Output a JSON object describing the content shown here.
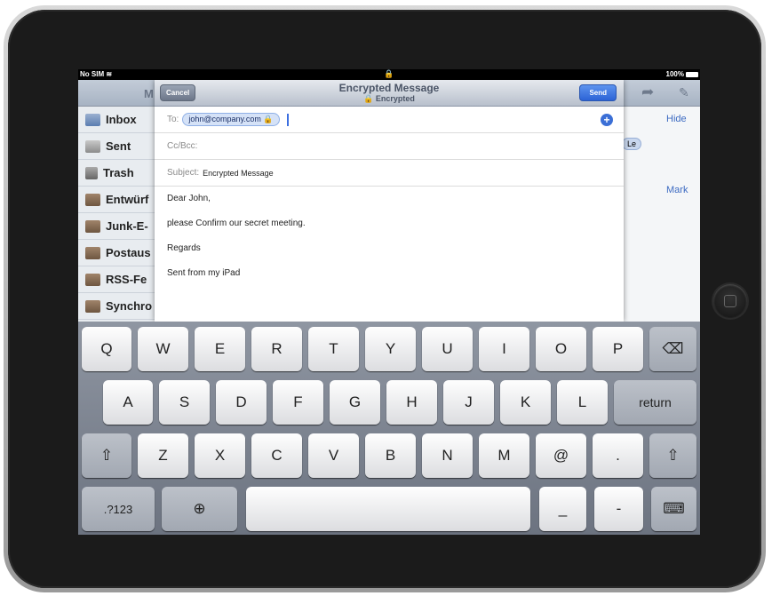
{
  "status_bar": {
    "carrier": "No SIM",
    "wifi_icon": "wifi-icon",
    "lock_icon": "padlock-icon",
    "battery": "100%"
  },
  "background_app": {
    "nav_title_fragment": "M",
    "mailboxes": [
      {
        "label": "Inbox",
        "icon": "inbox-icon"
      },
      {
        "label": "Sent",
        "icon": "sent-icon"
      },
      {
        "label": "Trash",
        "icon": "trash-icon"
      },
      {
        "label": "Entwürf",
        "icon": "folder-icon"
      },
      {
        "label": "Junk-E-",
        "icon": "folder-icon"
      },
      {
        "label": "Postaus",
        "icon": "folder-icon"
      },
      {
        "label": "RSS-Fe",
        "icon": "folder-icon"
      },
      {
        "label": "Synchro",
        "icon": "folder-icon"
      }
    ],
    "hide_label": "Hide",
    "mark_label": "Mark",
    "chip_fragment": "Le"
  },
  "compose": {
    "cancel_label": "Cancel",
    "title": "Encrypted Message",
    "subtitle": "Encrypted",
    "send_label": "Send",
    "to_label": "To:",
    "to_recipient": "john@company.com",
    "cc_label": "Cc/Bcc:",
    "subject_label": "Subject:",
    "subject_value": "Encrypted Message",
    "body_lines": [
      "Dear John,",
      "please Confirm our secret meeting.",
      "Regards",
      "Sent from my iPad"
    ]
  },
  "keyboard": {
    "row1": [
      "Q",
      "W",
      "E",
      "R",
      "T",
      "Y",
      "U",
      "I",
      "O",
      "P"
    ],
    "row2": [
      "A",
      "S",
      "D",
      "F",
      "G",
      "H",
      "J",
      "K",
      "L"
    ],
    "return_label": "return",
    "row3": [
      "Z",
      "X",
      "C",
      "V",
      "B",
      "N",
      "M",
      "@",
      "."
    ],
    "numbers_label": ".?123",
    "underscore": "_",
    "dash": "-"
  }
}
